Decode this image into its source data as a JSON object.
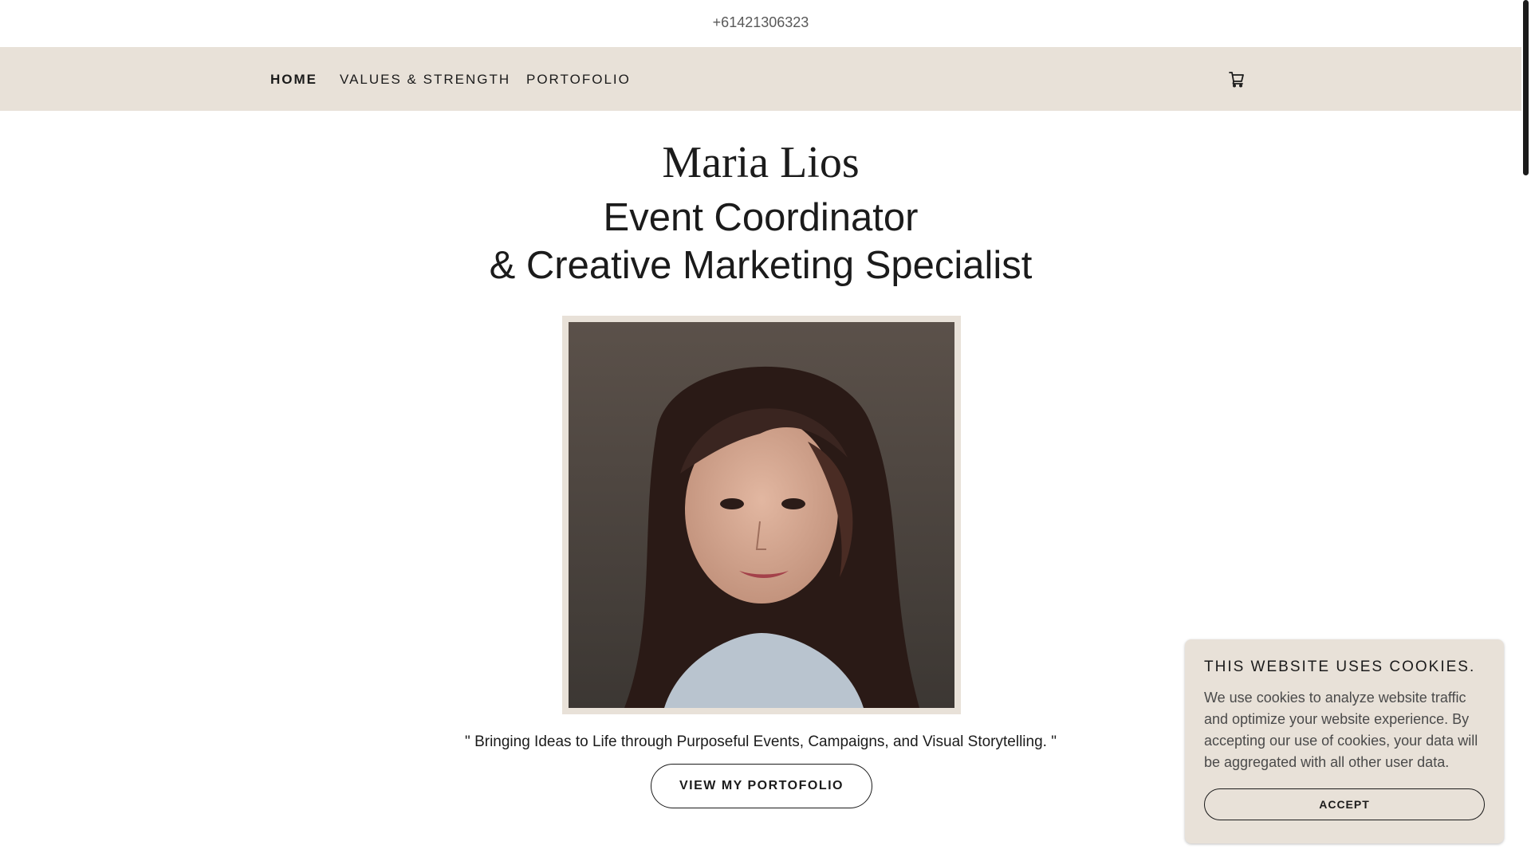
{
  "topbar": {
    "phone": "+61421306323"
  },
  "nav": {
    "items": [
      {
        "label": "HOME"
      },
      {
        "label": "VALUES & STRENGTH"
      },
      {
        "label": "PORTOFOLIO"
      }
    ],
    "cart_icon": "cart-icon"
  },
  "hero": {
    "name": "Maria Lios",
    "headline_line1": "Event Coordinator",
    "headline_line2": "& Creative Marketing Specialist",
    "tagline": "\" Bringing Ideas to Life through Purposeful Events, Campaigns, and Visual Storytelling. \"",
    "cta_label": "VIEW MY PORTOFOLIO"
  },
  "cookie_banner": {
    "title": "THIS WEBSITE USES COOKIES.",
    "text": "We use cookies to analyze website traffic and optimize your website experience. By accepting our use of cookies, your data will be aggregated with all other user data.",
    "accept_label": "ACCEPT"
  },
  "colors": {
    "nav_background": "#e8e1d8",
    "text": "#1b1b1b",
    "background": "#ffffff"
  }
}
